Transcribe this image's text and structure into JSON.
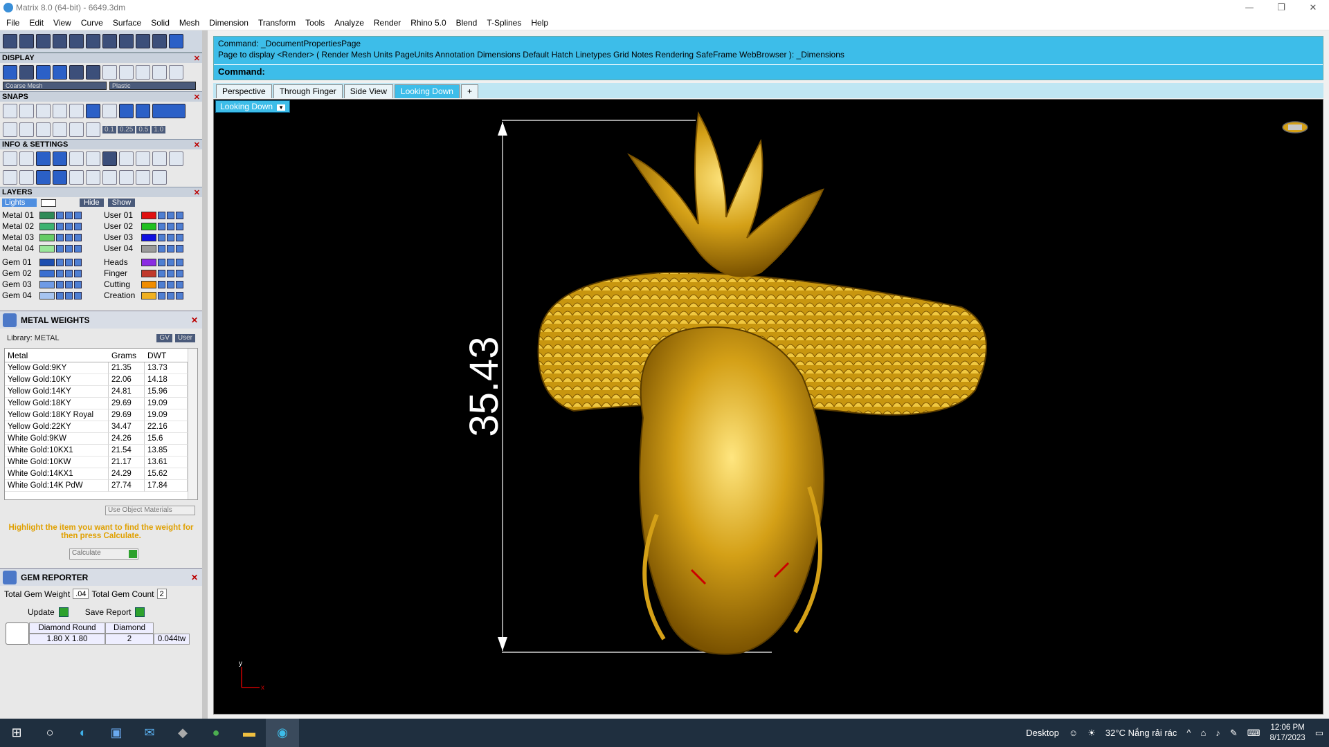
{
  "window": {
    "title": "Matrix 8.0 (64-bit) - 6649.3dm"
  },
  "menu": [
    "File",
    "Edit",
    "View",
    "Curve",
    "Surface",
    "Solid",
    "Mesh",
    "Dimension",
    "Transform",
    "Tools",
    "Analyze",
    "Render",
    "Rhino 5.0",
    "Blend",
    "T-Splines",
    "Help"
  ],
  "display": {
    "header": "DISPLAY",
    "mesh_select": "Coarse Mesh",
    "material_select": "Plastic"
  },
  "snaps": {
    "header": "SNAPS",
    "steps": [
      "0.1",
      "0.25",
      "0.5",
      "1.0"
    ]
  },
  "info": {
    "header": "INFO & SETTINGS"
  },
  "layers": {
    "header": "LAYERS",
    "lights": "Lights",
    "hide": "Hide",
    "show": "Show",
    "left": [
      {
        "name": "Metal 01",
        "color": "#2e8b57"
      },
      {
        "name": "Metal 02",
        "color": "#3cb371"
      },
      {
        "name": "Metal 03",
        "color": "#66cc66"
      },
      {
        "name": "Metal 04",
        "color": "#99e699"
      },
      {
        "name": "Gem 01",
        "color": "#1e4fb0"
      },
      {
        "name": "Gem 02",
        "color": "#3b6fd0"
      },
      {
        "name": "Gem 03",
        "color": "#6f9be6"
      },
      {
        "name": "Gem 04",
        "color": "#a6c4f0"
      }
    ],
    "right": [
      {
        "name": "User 01",
        "color": "#e01010"
      },
      {
        "name": "User 02",
        "color": "#20c020"
      },
      {
        "name": "User 03",
        "color": "#1010e0"
      },
      {
        "name": "User 04",
        "color": "#9a9a9a"
      },
      {
        "name": "Heads",
        "color": "#8a2be2"
      },
      {
        "name": "Finger",
        "color": "#c0392b"
      },
      {
        "name": "Cutting",
        "color": "#f08c00"
      },
      {
        "name": "Creation",
        "color": "#f0b020"
      }
    ]
  },
  "metal_weights": {
    "header": "METAL WEIGHTS",
    "library": "Library: METAL",
    "btn_gv": "GV",
    "btn_user": "User",
    "columns": [
      "Metal",
      "Grams",
      "DWT"
    ],
    "rows": [
      [
        "Yellow Gold:9KY",
        "21.35",
        "13.73"
      ],
      [
        "Yellow Gold:10KY",
        "22.06",
        "14.18"
      ],
      [
        "Yellow Gold:14KY",
        "24.81",
        "15.96"
      ],
      [
        "Yellow Gold:18KY",
        "29.69",
        "19.09"
      ],
      [
        "Yellow Gold:18KY Royal",
        "29.69",
        "19.09"
      ],
      [
        "Yellow Gold:22KY",
        "34.47",
        "22.16"
      ],
      [
        "White Gold:9KW",
        "24.26",
        "15.6"
      ],
      [
        "White Gold:10KX1",
        "21.54",
        "13.85"
      ],
      [
        "White Gold:10KW",
        "21.17",
        "13.61"
      ],
      [
        "White Gold:14KX1",
        "24.29",
        "15.62"
      ],
      [
        "White Gold:14K PdW",
        "27.74",
        "17.84"
      ]
    ],
    "use_object_materials": "Use Object Materials",
    "hint": "Highlight the item you want to find the weight for then press Calculate.",
    "calculate": "Calculate"
  },
  "gem_reporter": {
    "header": "GEM REPORTER",
    "total_weight_label": "Total Gem Weight",
    "total_weight": ".04",
    "total_count_label": "Total Gem Count",
    "total_count": "2",
    "update": "Update",
    "save_report": "Save Report",
    "gem": {
      "shape": "Diamond Round",
      "type": "Diamond",
      "size": "1.80 X 1.80",
      "count": "2",
      "weight": "0.044tw"
    }
  },
  "command": {
    "line1": "Command: _DocumentPropertiesPage",
    "line2": "Page to display <Render> ( Render  Mesh  Units  PageUnits  Annotation  Dimensions  Default  Hatch  Linetypes  Grid  Notes  Rendering  SafeFrame  WebBrowser ): _Dimensions",
    "prompt": "Command:"
  },
  "viewport_tabs": [
    "Perspective",
    "Through Finger",
    "Side View",
    "Looking Down"
  ],
  "active_tab": "Looking Down",
  "viewport": {
    "label": "Looking Down",
    "dimension": "35.43",
    "axis_y": "y",
    "axis_x": "x"
  },
  "colors": {
    "accent": "#3dbde9",
    "model": "#d4a017",
    "hint": "#e0a000"
  },
  "taskbar": {
    "desktop": "Desktop",
    "weather": "32°C  Nắng rải rác",
    "time": "12:06 PM",
    "date": "8/17/2023"
  }
}
